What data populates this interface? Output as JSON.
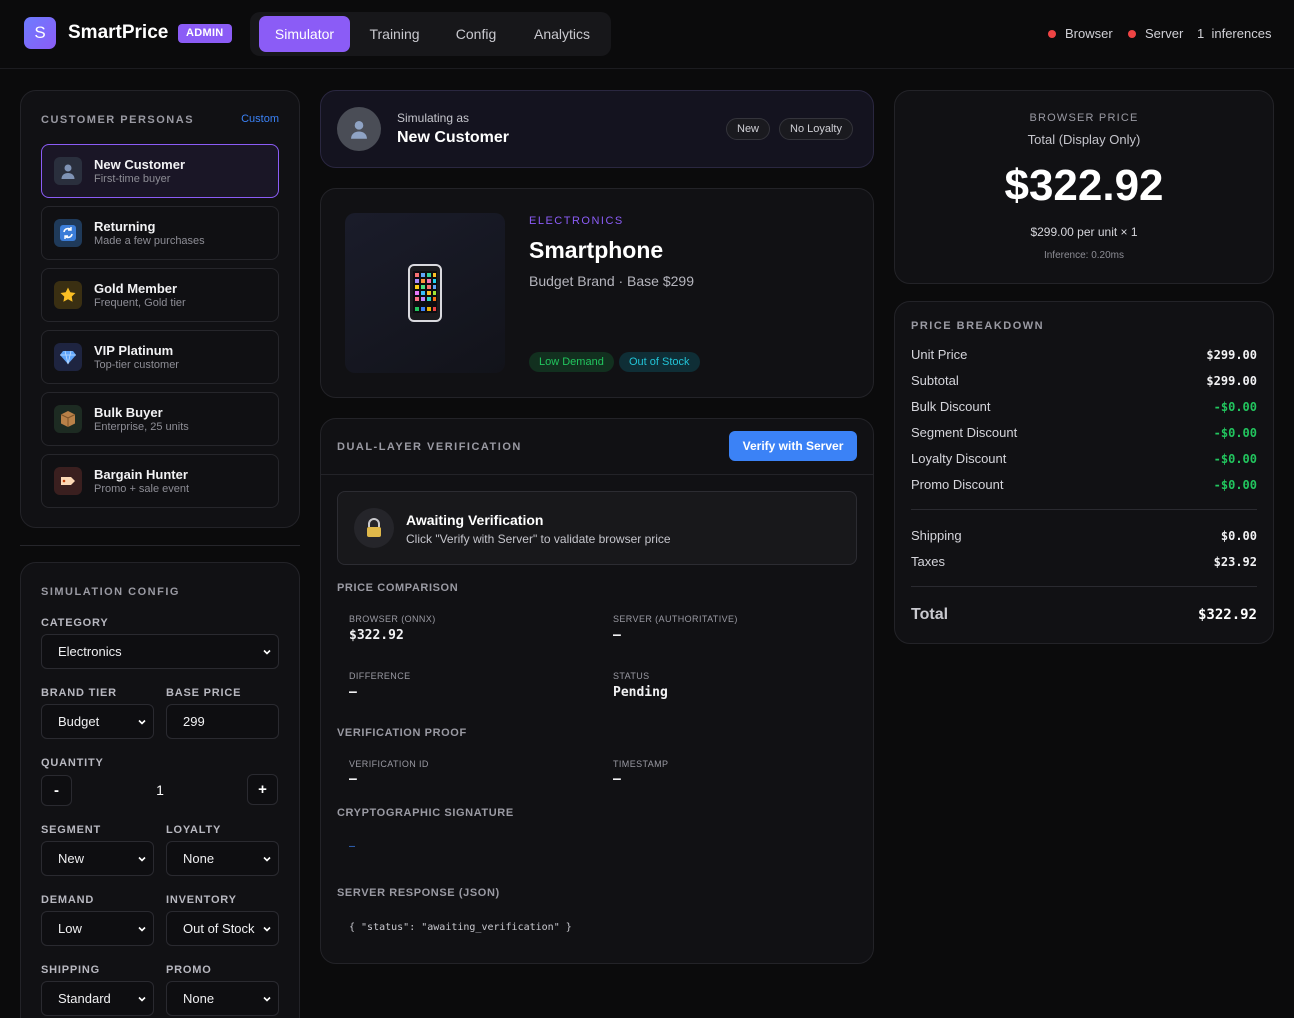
{
  "app": {
    "logo_letter": "S",
    "name": "SmartPrice",
    "badge": "ADMIN"
  },
  "nav": {
    "tabs": [
      {
        "label": "Simulator",
        "active": true
      },
      {
        "label": "Training",
        "active": false
      },
      {
        "label": "Config",
        "active": false
      },
      {
        "label": "Analytics",
        "active": false
      }
    ]
  },
  "status": {
    "browser": "Browser",
    "server": "Server",
    "inference_count": "1",
    "inference_label": "inferences",
    "dot_color": "#ef4444"
  },
  "personas": {
    "title": "CUSTOMER PERSONAS",
    "custom_link": "Custom",
    "items": [
      {
        "icon": "person-icon",
        "name": "New Customer",
        "desc": "First-time buyer",
        "active": true
      },
      {
        "icon": "refresh-icon",
        "name": "Returning",
        "desc": "Made a few purchases",
        "active": false
      },
      {
        "icon": "star-icon",
        "name": "Gold Member",
        "desc": "Frequent, Gold tier",
        "active": false
      },
      {
        "icon": "diamond-icon",
        "name": "VIP Platinum",
        "desc": "Top-tier customer",
        "active": false
      },
      {
        "icon": "package-icon",
        "name": "Bulk Buyer",
        "desc": "Enterprise, 25 units",
        "active": false
      },
      {
        "icon": "tag-icon",
        "name": "Bargain Hunter",
        "desc": "Promo + sale event",
        "active": false
      }
    ]
  },
  "config": {
    "title": "SIMULATION CONFIG",
    "category_label": "CATEGORY",
    "category": "Electronics",
    "brand_label": "BRAND TIER",
    "brand": "Budget",
    "base_price_label": "BASE PRICE",
    "base_price": "299",
    "quantity_label": "QUANTITY",
    "quantity": "1",
    "minus": "-",
    "plus": "+",
    "segment_label": "SEGMENT",
    "segment": "New",
    "loyalty_label": "LOYALTY",
    "loyalty": "None",
    "demand_label": "DEMAND",
    "demand": "Low",
    "inventory_label": "INVENTORY",
    "inventory": "Out of Stock",
    "shipping_label": "SHIPPING",
    "shipping": "Standard",
    "promo_label": "PROMO",
    "promo": "None"
  },
  "sim_header": {
    "simulating_as": "Simulating as",
    "persona": "New Customer",
    "chips": [
      "New",
      "No Loyalty"
    ]
  },
  "product": {
    "category": "ELECTRONICS",
    "name": "Smartphone",
    "meta": "Budget Brand · Base $299",
    "tags": [
      {
        "label": "Low Demand",
        "color": "#22c55e"
      },
      {
        "label": "Out of Stock",
        "color": "#22c3d6"
      }
    ]
  },
  "verification": {
    "title": "DUAL-LAYER VERIFICATION",
    "button": "Verify with Server",
    "await_title": "Awaiting Verification",
    "await_desc": "Click \"Verify with Server\" to validate browser price",
    "price_comparison": "PRICE COMPARISON",
    "browser_label": "BROWSER (ONNX)",
    "browser_value": "$322.92",
    "server_label": "SERVER (AUTHORITATIVE)",
    "server_value": "—",
    "difference_label": "DIFFERENCE",
    "difference_value": "—",
    "status_label": "STATUS",
    "status_value": "Pending",
    "proof_title": "VERIFICATION PROOF",
    "vid_label": "VERIFICATION ID",
    "vid_value": "—",
    "ts_label": "TIMESTAMP",
    "ts_value": "—",
    "sig_title": "CRYPTOGRAPHIC SIGNATURE",
    "sig_value": "—",
    "json_title": "SERVER RESPONSE (JSON)",
    "json_value": "{ \"status\": \"awaiting_verification\" }"
  },
  "browser_price": {
    "title": "BROWSER PRICE",
    "subtitle": "Total (Display Only)",
    "amount": "$322.92",
    "per_unit": "$299.00 per unit × 1",
    "inference": "Inference: 0.20ms"
  },
  "breakdown": {
    "title": "PRICE BREAKDOWN",
    "rows": [
      {
        "label": "Unit Price",
        "value": "$299.00",
        "discount": false
      },
      {
        "label": "Subtotal",
        "value": "$299.00",
        "discount": false
      },
      {
        "label": "Bulk Discount",
        "value": "-$0.00",
        "discount": true
      },
      {
        "label": "Segment Discount",
        "value": "-$0.00",
        "discount": true
      },
      {
        "label": "Loyalty Discount",
        "value": "-$0.00",
        "discount": true
      },
      {
        "label": "Promo Discount",
        "value": "-$0.00",
        "discount": true
      }
    ],
    "shipping_label": "Shipping",
    "shipping_value": "$0.00",
    "taxes_label": "Taxes",
    "taxes_value": "$23.92",
    "total_label": "Total",
    "total_value": "$322.92"
  }
}
